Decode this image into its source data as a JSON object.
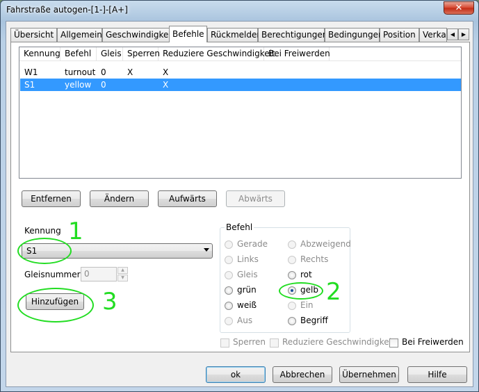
{
  "window": {
    "title": "Fahrstraße autogen-[1-]-[A+]",
    "close_glyph": "✕"
  },
  "tabs": [
    {
      "label": "Übersicht"
    },
    {
      "label": "Allgemein"
    },
    {
      "label": "Geschwindigkeit"
    },
    {
      "label": "Befehle"
    },
    {
      "label": "Rückmelder"
    },
    {
      "label": "Berechtigungen"
    },
    {
      "label": "Bedingungen"
    },
    {
      "label": "Position"
    },
    {
      "label": "Verka"
    }
  ],
  "tab_scroll": {
    "left": "◀",
    "right": "▶"
  },
  "list": {
    "columns": [
      "Kennung",
      "Befehl",
      "Gleis",
      "Sperren",
      "Reduziere Geschwindigkeit",
      "Bei Freiwerden"
    ],
    "rows": [
      {
        "kennung": "W1",
        "befehl": "turnout",
        "gleis": "0",
        "sperren": "X",
        "reduziere": "X",
        "freiwerden": ""
      },
      {
        "kennung": "S1",
        "befehl": "yellow",
        "gleis": "0",
        "sperren": "",
        "reduziere": "X",
        "freiwerden": "",
        "selected": true
      }
    ]
  },
  "buttons": {
    "entfernen": "Entfernen",
    "aendern": "Ändern",
    "aufwaerts": "Aufwärts",
    "abwaerts": "Abwärts",
    "hinzufuegen": "Hinzufügen",
    "ok": "ok",
    "abbrechen": "Abbrechen",
    "uebernehmen": "Übernehmen",
    "hilfe": "Hilfe"
  },
  "kennung": {
    "label": "Kennung",
    "value": "S1"
  },
  "gleisnummer": {
    "label": "Gleisnummer",
    "value": "0",
    "up": "▲",
    "down": "▼"
  },
  "befehl_group": {
    "title": "Befehl",
    "options_left": [
      {
        "label": "Gerade",
        "enabled": false,
        "checked": false
      },
      {
        "label": "Links",
        "enabled": false,
        "checked": false
      },
      {
        "label": "Gleis",
        "enabled": false,
        "checked": false
      },
      {
        "label": "grün",
        "enabled": true,
        "checked": false
      },
      {
        "label": "weiß",
        "enabled": true,
        "checked": false
      },
      {
        "label": "Aus",
        "enabled": false,
        "checked": false
      }
    ],
    "options_right": [
      {
        "label": "Abzweigend",
        "enabled": false,
        "checked": false
      },
      {
        "label": "Rechts",
        "enabled": false,
        "checked": false
      },
      {
        "label": "rot",
        "enabled": true,
        "checked": false
      },
      {
        "label": "gelb",
        "enabled": true,
        "checked": true
      },
      {
        "label": "Ein",
        "enabled": false,
        "checked": false
      },
      {
        "label": "Begriff",
        "enabled": true,
        "checked": false
      }
    ]
  },
  "checkboxes": {
    "sperren": "Sperren",
    "reduziere": "Reduziere Geschwindigkeit",
    "bei_freiwerden": "Bei Freiwerden"
  },
  "annotations": {
    "one": "1",
    "two": "2",
    "three": "3"
  },
  "colors": {
    "selection": "#3399ff",
    "annotation": "#22dd22"
  }
}
